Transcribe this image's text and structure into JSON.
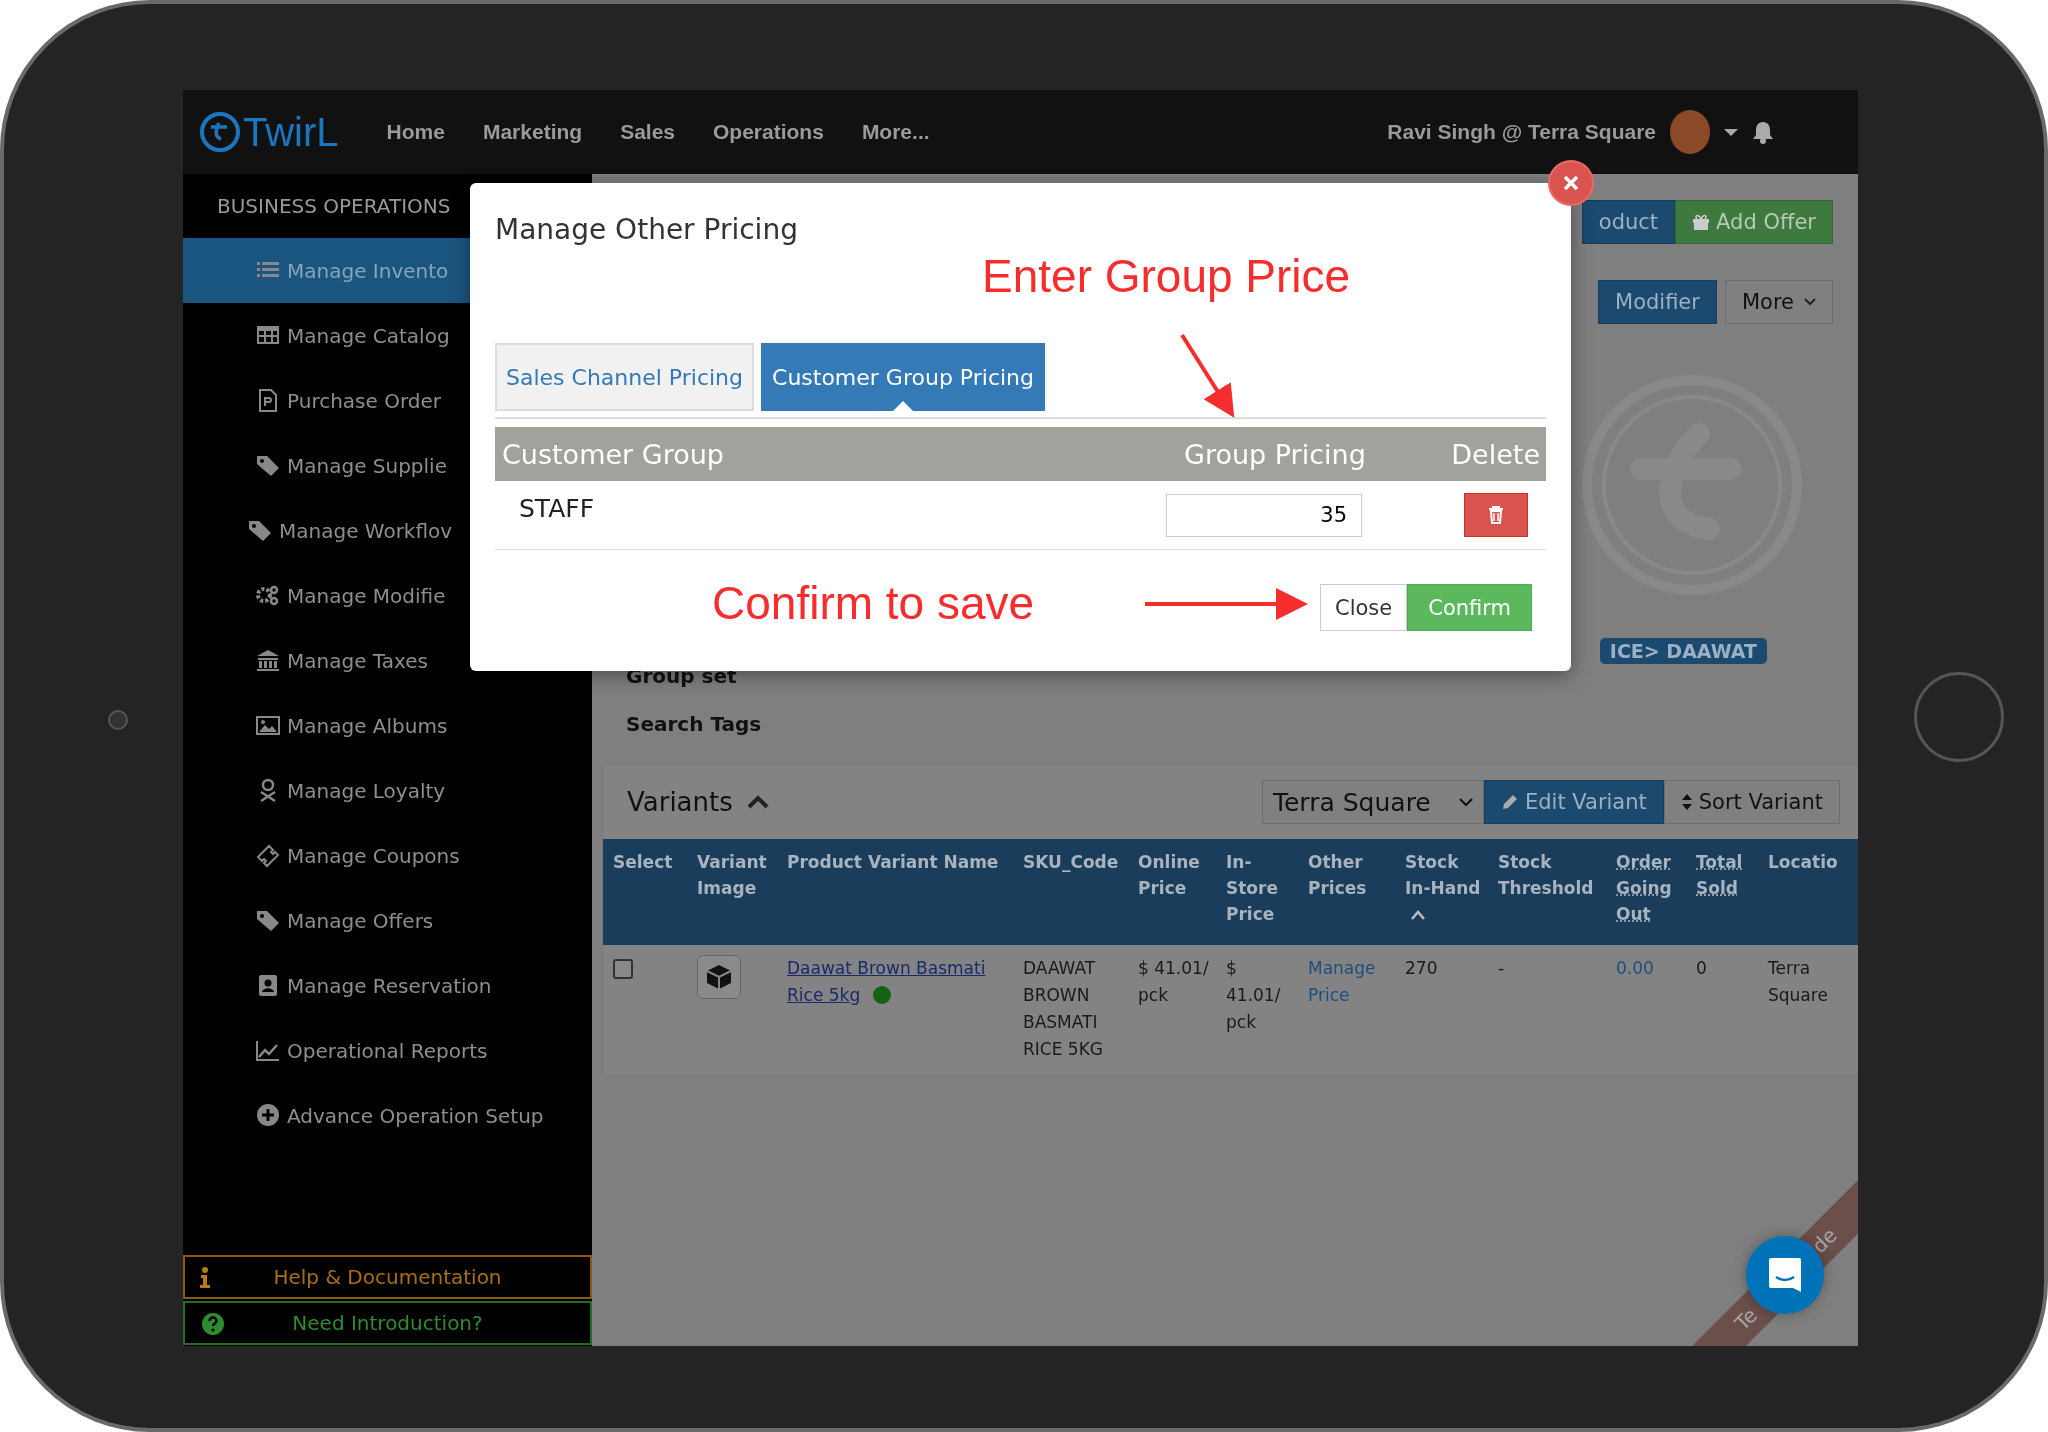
{
  "topbar": {
    "logo": "TwirL",
    "nav": [
      {
        "label": "Home"
      },
      {
        "label": "Marketing"
      },
      {
        "label": "Sales"
      },
      {
        "label": "Operations"
      },
      {
        "label": "More..."
      }
    ],
    "user": "Ravi Singh @ Terra Square"
  },
  "sidebar": {
    "title": "BUSINESS OPERATIONS",
    "items": [
      {
        "label": "Manage Invento",
        "selected": true
      },
      {
        "label": "Manage Catalog",
        "selected": false
      },
      {
        "label": "Purchase Order",
        "selected": false
      },
      {
        "label": "Manage Supplie",
        "selected": false
      },
      {
        "label": "Manage Workflov",
        "selected": false
      },
      {
        "label": "Manage Modifie",
        "selected": false
      },
      {
        "label": "Manage Taxes",
        "selected": false
      },
      {
        "label": "Manage Albums",
        "selected": false
      },
      {
        "label": "Manage Loyalty",
        "selected": false
      },
      {
        "label": "Manage Coupons",
        "selected": false
      },
      {
        "label": "Manage Offers",
        "selected": false
      },
      {
        "label": "Manage Reservation",
        "selected": false
      },
      {
        "label": "Operational Reports",
        "selected": false
      },
      {
        "label": "Advance Operation Setup",
        "selected": false
      }
    ],
    "footer_links": [
      {
        "label": "Help & Documentation",
        "kind": "help"
      },
      {
        "label": "Need Introduction?",
        "kind": "intro"
      }
    ]
  },
  "actions": [
    {
      "label": "oduct",
      "kind": "primary"
    },
    {
      "label": "Add Offer",
      "kind": "success"
    }
  ],
  "actions_2": [
    {
      "label": "Modifier",
      "kind": "primary"
    },
    {
      "label": "More",
      "kind": "dropdown"
    }
  ],
  "tag": "ICE> DAAWAT",
  "fields": [
    "Group set",
    "Search Tags"
  ],
  "variants": {
    "title": "Variants",
    "store_select": "Terra Square",
    "buttons": [
      {
        "label": "Edit Variant",
        "kind": "primary"
      },
      {
        "label": "Sort Variant",
        "kind": "default"
      }
    ],
    "columns": [
      {
        "label": "Select",
        "underlined": false,
        "sorted": false
      },
      {
        "label": "Variant Image",
        "underlined": false,
        "sorted": false
      },
      {
        "label": "Product Variant Name",
        "underlined": false,
        "sorted": false
      },
      {
        "label": "SKU_Code",
        "underlined": false,
        "sorted": false
      },
      {
        "label": "Online Price",
        "underlined": false,
        "sorted": false
      },
      {
        "label": "In-Store Price",
        "underlined": false,
        "sorted": false
      },
      {
        "label": "Other Prices",
        "underlined": false,
        "sorted": false
      },
      {
        "label": "Stock In-Hand",
        "underlined": false,
        "sorted": true
      },
      {
        "label": "Stock Threshold",
        "underlined": false,
        "sorted": false
      },
      {
        "label": "Order Going Out",
        "underlined": true,
        "sorted": false
      },
      {
        "label": "Total Sold",
        "underlined": true,
        "sorted": false
      },
      {
        "label": "Locatio",
        "underlined": false,
        "sorted": false
      }
    ],
    "rows": [
      {
        "checked": false,
        "name": "Daawat Brown Basmati Rice 5kg",
        "active": true,
        "sku": "DAAWAT BROWN BASMATI RICE 5KG",
        "online_price": "$ 41.01/ pck",
        "instore_price": "$ 41.01/ pck",
        "other_prices": "Manage Price",
        "stock": "270",
        "threshold": "-",
        "order_going_out": "0.00",
        "total_sold": "0",
        "location": "Terra Square"
      }
    ]
  },
  "modal": {
    "title": "Manage Other Pricing",
    "tabs": [
      {
        "label": "Sales Channel Pricing",
        "selected": false
      },
      {
        "label": "Customer Group Pricing",
        "selected": true
      }
    ],
    "columns": [
      "Customer Group",
      "Group Pricing",
      "Delete"
    ],
    "rows": [
      {
        "group": "STAFF",
        "price": "35"
      }
    ],
    "buttons": [
      {
        "label": "Close",
        "kind": "default"
      },
      {
        "label": "Confirm",
        "kind": "success"
      }
    ]
  },
  "annotations": [
    {
      "text": "Enter Group Price"
    },
    {
      "text": "Confirm to save"
    }
  ],
  "ribbon": {
    "texts": [
      "Te",
      "de"
    ]
  }
}
